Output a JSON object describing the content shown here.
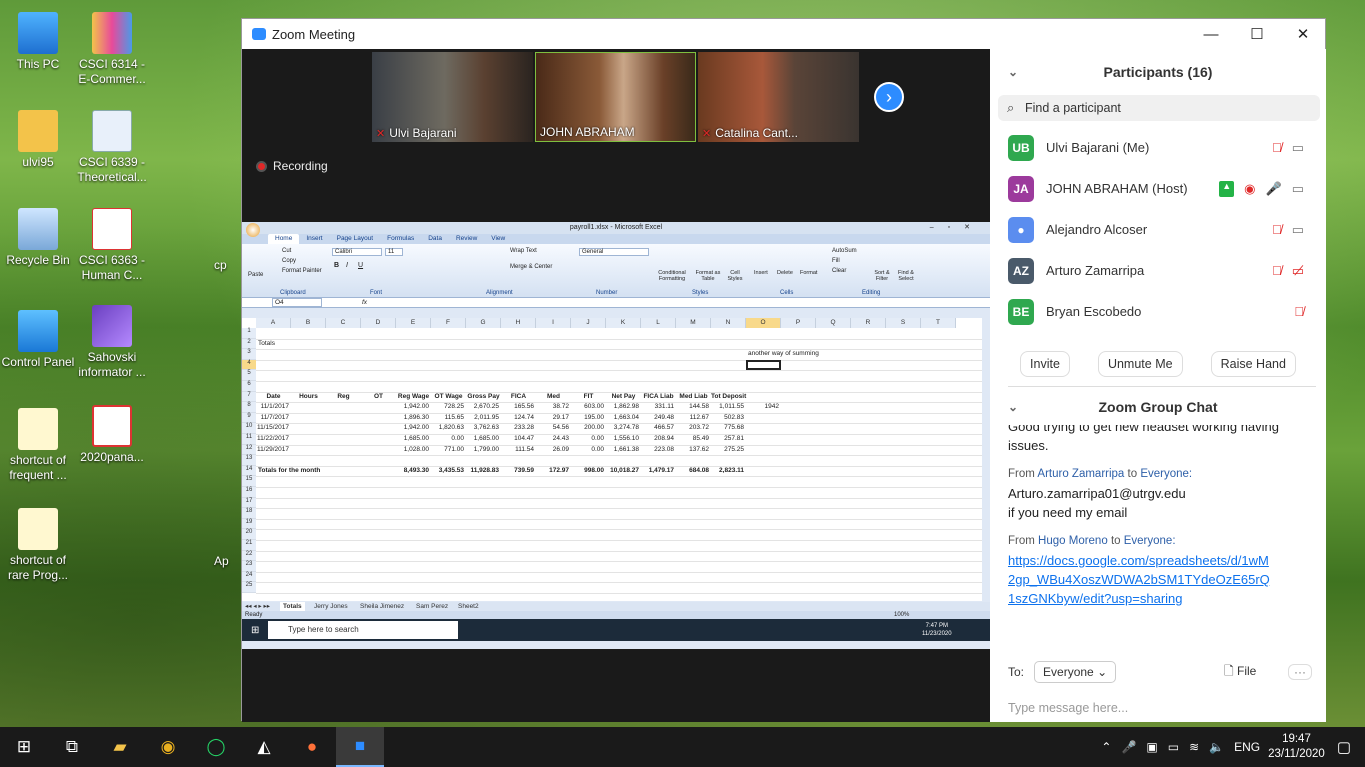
{
  "desktop": {
    "icons": [
      {
        "label": "This PC"
      },
      {
        "label": "CSCI 6314 - E-Commer..."
      },
      {
        "label": "ulvi95"
      },
      {
        "label": "CSCI 6339 - Theoretical..."
      },
      {
        "label": "Recycle Bin"
      },
      {
        "label": "CSCI 6363 - Human C..."
      },
      {
        "label": "Control Panel"
      },
      {
        "label": "Sahovski informator ..."
      },
      {
        "label": "shortcut of frequent ..."
      },
      {
        "label": "2020pana..."
      },
      {
        "label": "shortcut of rare Prog..."
      },
      {
        "label": "cp"
      },
      {
        "label": "Ap"
      }
    ]
  },
  "zoom": {
    "title": "Zoom Meeting",
    "videos": [
      {
        "name": "Ulvi Bajarani"
      },
      {
        "name": "JOHN ABRAHAM"
      },
      {
        "name": "Catalina Cant..."
      }
    ],
    "recording": "Recording",
    "participants_title": "Participants (16)",
    "search_placeholder": "Find a participant",
    "participants": [
      {
        "initials": "UB",
        "name": "Ulvi Bajarani (Me)",
        "color": "#2fa84f"
      },
      {
        "initials": "JA",
        "name": "JOHN ABRAHAM (Host)",
        "color": "#9c3a9c"
      },
      {
        "initials": "",
        "name": "Alejandro Alcoser",
        "color": "#5b8def"
      },
      {
        "initials": "AZ",
        "name": "Arturo Zamarripa",
        "color": "#4a5a6a"
      },
      {
        "initials": "BE",
        "name": "Bryan Escobedo",
        "color": "#2fa84f"
      }
    ],
    "buttons": {
      "invite": "Invite",
      "unmute": "Unmute Me",
      "raise": "Raise Hand"
    },
    "chat_title": "Zoom Group Chat",
    "chat": {
      "m0": "Good trying to get new headset working having issues.",
      "m1_from": "From",
      "m1_who": "Arturo Zamarripa",
      "m1_to": "to",
      "m1_target": "Everyone:",
      "m1_line1": "Arturo.zamarripa01@utrgv.edu",
      "m1_line2": "if you need my email",
      "m2_from": "From",
      "m2_who": "Hugo Moreno",
      "m2_to": "to",
      "m2_target": "Everyone:",
      "m2_link": "https://docs.google.com/spreadsheets/d/1wM2gp_WBu4XoszWDWA2bSM1TYdeOzE65rQ1szGNKbyw/edit?usp=sharing"
    },
    "to_label": "To:",
    "to_value": "Everyone",
    "file_label": "File",
    "type_placeholder": "Type message here..."
  },
  "excel": {
    "title": "payroll1.xlsx - Microsoft Excel",
    "tabs": [
      "Home",
      "Insert",
      "Page Layout",
      "Formulas",
      "Data",
      "Review",
      "View"
    ],
    "groups": [
      "Clipboard",
      "Font",
      "Alignment",
      "Number",
      "Styles",
      "Cells",
      "Editing"
    ],
    "ribbon": {
      "cut": "Cut",
      "copy": "Copy",
      "format_painter": "Format Painter",
      "paste": "Paste",
      "font": "Calibri",
      "size": "11",
      "wrap": "Wrap Text",
      "merge": "Merge & Center",
      "number_format": "General",
      "cond": "Conditional Formatting",
      "format_table": "Format as Table",
      "cell_styles": "Cell Styles",
      "insert": "Insert",
      "delete": "Delete",
      "format": "Format",
      "autosum": "AutoSum",
      "fill": "Fill",
      "clear": "Clear",
      "sort": "Sort & Filter",
      "find": "Find & Select"
    },
    "namebox": "O4",
    "columns": [
      "A",
      "B",
      "C",
      "D",
      "E",
      "F",
      "G",
      "H",
      "I",
      "J",
      "K",
      "L",
      "M",
      "N",
      "O",
      "P",
      "Q",
      "R",
      "S",
      "T"
    ],
    "rows": [
      "1",
      "2",
      "3",
      "4",
      "5",
      "6",
      "7",
      "8",
      "9",
      "10",
      "11",
      "12",
      "13",
      "14",
      "15",
      "16",
      "17",
      "18",
      "19",
      "20",
      "21",
      "22",
      "23",
      "24",
      "25"
    ],
    "totals_label": "Totals",
    "note": "another way of summing",
    "headers": [
      "Date",
      "Hours",
      "Reg",
      "OT",
      "Reg Wage",
      "OT Wage",
      "Gross Pay",
      "FICA",
      "Med",
      "FIT",
      "Net Pay",
      "FICA Liab",
      "Med Liab",
      "Tot Deposit"
    ],
    "data": [
      [
        "11/1/2017",
        "",
        "",
        "",
        "1,942.00",
        "728.25",
        "2,670.25",
        "165.56",
        "38.72",
        "603.00",
        "1,862.98",
        "331.11",
        "144.58",
        "1,011.55",
        "1942"
      ],
      [
        "11/7/2017",
        "",
        "",
        "",
        "1,896.30",
        "115.65",
        "2,011.95",
        "124.74",
        "29.17",
        "195.00",
        "1,663.04",
        "249.48",
        "112.67",
        "502.83",
        ""
      ],
      [
        "11/15/2017",
        "",
        "",
        "",
        "1,942.00",
        "1,820.63",
        "3,762.63",
        "233.28",
        "54.56",
        "200.00",
        "3,274.78",
        "466.57",
        "203.72",
        "775.68",
        ""
      ],
      [
        "11/22/2017",
        "",
        "",
        "",
        "1,685.00",
        "0.00",
        "1,685.00",
        "104.47",
        "24.43",
        "0.00",
        "1,556.10",
        "208.94",
        "85.49",
        "257.81",
        ""
      ],
      [
        "11/29/2017",
        "",
        "",
        "",
        "1,028.00",
        "771.00",
        "1,799.00",
        "111.54",
        "26.09",
        "0.00",
        "1,661.38",
        "223.08",
        "137.62",
        "275.25",
        ""
      ]
    ],
    "month_label": "Totals for the month",
    "month_totals": [
      "8,493.30",
      "3,435.53",
      "11,928.83",
      "739.59",
      "172.97",
      "998.00",
      "10,018.27",
      "1,479.17",
      "684.08",
      "2,823.11"
    ],
    "sheets": [
      "Totals",
      "Jerry Jones",
      "Sheila Jimenez",
      "Sam Perez",
      "Sheet2"
    ],
    "status": "Ready",
    "zoom_level": "100%",
    "inner_search": "Type here to search",
    "inner_time": "7:47 PM",
    "inner_date": "11/23/2020"
  },
  "taskbar": {
    "lang": "ENG",
    "time": "19:47",
    "date": "23/11/2020"
  }
}
